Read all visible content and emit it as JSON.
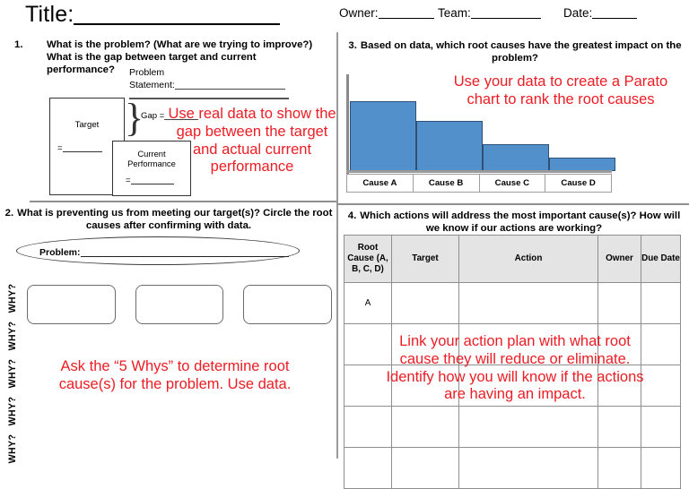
{
  "header": {
    "title_label": "Title:",
    "owner_label": "Owner:",
    "team_label": "Team:",
    "date_label": "Date:"
  },
  "q1": {
    "number": "1.",
    "question": "What is the problem? (What are we trying to improve?) What is the gap between target and current performance?",
    "problem_statement_line1": "Problem",
    "problem_statement_line2": "Statement:",
    "target_label": "Target",
    "target_eq": "=",
    "current_label_line1": "Current",
    "current_label_line2": "Performance",
    "current_eq": "=",
    "gap_label": "Gap =",
    "note": "Use real data to show the gap between the target and actual current performance"
  },
  "q2": {
    "number": "2.",
    "question": "What is preventing us from meeting our target(s)? Circle the root causes after confirming with data.",
    "problem_label": "Problem:",
    "why_labels": [
      "WHY?",
      "WHY?",
      "WHY?",
      "WHY?",
      "WHY?"
    ],
    "note": "Ask the “5 Whys” to determine root cause(s) for the problem. Use data."
  },
  "q3": {
    "number": "3.",
    "question": "Based on data, which root causes have the greatest impact on the problem?",
    "note": "Use your data to create a Parato chart to rank the root causes"
  },
  "q4": {
    "number": "4.",
    "question": "Which actions will address the most important cause(s)? How will we know if our actions are working?",
    "columns": [
      "Root Cause (A, B, C, D)",
      "Target",
      "Action",
      "Owner",
      "Due Date"
    ],
    "rows": [
      [
        "A",
        "",
        "",
        "",
        ""
      ],
      [
        "",
        "",
        "",
        "",
        ""
      ],
      [
        "",
        "",
        "",
        "",
        ""
      ],
      [
        "",
        "",
        "",
        "",
        ""
      ],
      [
        "",
        "",
        "",
        "",
        ""
      ]
    ],
    "note": "Link your action plan with what root cause they will reduce or eliminate. Identify how you will know if the actions are having an impact."
  },
  "colors": {
    "annotation_red": "#EC1C24",
    "bar_blue": "#5190CB",
    "bar_border": "#2F4F74",
    "table_header_bg": "#E4E4E4"
  },
  "chart_data": {
    "type": "bar",
    "title": "Pareto chart of root causes",
    "categories": [
      "Cause A",
      "Cause B",
      "Cause C",
      "Cause D"
    ],
    "values": [
      72,
      52,
      28,
      14
    ],
    "xlabel": "",
    "ylabel": "",
    "ylim": [
      0,
      100
    ],
    "grid": false,
    "legend": "none",
    "bar_color": "#5190CB"
  }
}
